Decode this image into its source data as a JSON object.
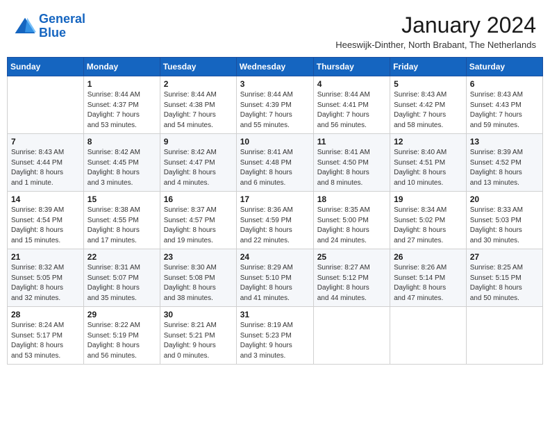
{
  "header": {
    "logo_line1": "General",
    "logo_line2": "Blue",
    "month_title": "January 2024",
    "subtitle": "Heeswijk-Dinther, North Brabant, The Netherlands"
  },
  "weekdays": [
    "Sunday",
    "Monday",
    "Tuesday",
    "Wednesday",
    "Thursday",
    "Friday",
    "Saturday"
  ],
  "weeks": [
    [
      {
        "day": "",
        "info": ""
      },
      {
        "day": "1",
        "info": "Sunrise: 8:44 AM\nSunset: 4:37 PM\nDaylight: 7 hours\nand 53 minutes."
      },
      {
        "day": "2",
        "info": "Sunrise: 8:44 AM\nSunset: 4:38 PM\nDaylight: 7 hours\nand 54 minutes."
      },
      {
        "day": "3",
        "info": "Sunrise: 8:44 AM\nSunset: 4:39 PM\nDaylight: 7 hours\nand 55 minutes."
      },
      {
        "day": "4",
        "info": "Sunrise: 8:44 AM\nSunset: 4:41 PM\nDaylight: 7 hours\nand 56 minutes."
      },
      {
        "day": "5",
        "info": "Sunrise: 8:43 AM\nSunset: 4:42 PM\nDaylight: 7 hours\nand 58 minutes."
      },
      {
        "day": "6",
        "info": "Sunrise: 8:43 AM\nSunset: 4:43 PM\nDaylight: 7 hours\nand 59 minutes."
      }
    ],
    [
      {
        "day": "7",
        "info": "Sunrise: 8:43 AM\nSunset: 4:44 PM\nDaylight: 8 hours\nand 1 minute."
      },
      {
        "day": "8",
        "info": "Sunrise: 8:42 AM\nSunset: 4:45 PM\nDaylight: 8 hours\nand 3 minutes."
      },
      {
        "day": "9",
        "info": "Sunrise: 8:42 AM\nSunset: 4:47 PM\nDaylight: 8 hours\nand 4 minutes."
      },
      {
        "day": "10",
        "info": "Sunrise: 8:41 AM\nSunset: 4:48 PM\nDaylight: 8 hours\nand 6 minutes."
      },
      {
        "day": "11",
        "info": "Sunrise: 8:41 AM\nSunset: 4:50 PM\nDaylight: 8 hours\nand 8 minutes."
      },
      {
        "day": "12",
        "info": "Sunrise: 8:40 AM\nSunset: 4:51 PM\nDaylight: 8 hours\nand 10 minutes."
      },
      {
        "day": "13",
        "info": "Sunrise: 8:39 AM\nSunset: 4:52 PM\nDaylight: 8 hours\nand 13 minutes."
      }
    ],
    [
      {
        "day": "14",
        "info": "Sunrise: 8:39 AM\nSunset: 4:54 PM\nDaylight: 8 hours\nand 15 minutes."
      },
      {
        "day": "15",
        "info": "Sunrise: 8:38 AM\nSunset: 4:55 PM\nDaylight: 8 hours\nand 17 minutes."
      },
      {
        "day": "16",
        "info": "Sunrise: 8:37 AM\nSunset: 4:57 PM\nDaylight: 8 hours\nand 19 minutes."
      },
      {
        "day": "17",
        "info": "Sunrise: 8:36 AM\nSunset: 4:59 PM\nDaylight: 8 hours\nand 22 minutes."
      },
      {
        "day": "18",
        "info": "Sunrise: 8:35 AM\nSunset: 5:00 PM\nDaylight: 8 hours\nand 24 minutes."
      },
      {
        "day": "19",
        "info": "Sunrise: 8:34 AM\nSunset: 5:02 PM\nDaylight: 8 hours\nand 27 minutes."
      },
      {
        "day": "20",
        "info": "Sunrise: 8:33 AM\nSunset: 5:03 PM\nDaylight: 8 hours\nand 30 minutes."
      }
    ],
    [
      {
        "day": "21",
        "info": "Sunrise: 8:32 AM\nSunset: 5:05 PM\nDaylight: 8 hours\nand 32 minutes."
      },
      {
        "day": "22",
        "info": "Sunrise: 8:31 AM\nSunset: 5:07 PM\nDaylight: 8 hours\nand 35 minutes."
      },
      {
        "day": "23",
        "info": "Sunrise: 8:30 AM\nSunset: 5:08 PM\nDaylight: 8 hours\nand 38 minutes."
      },
      {
        "day": "24",
        "info": "Sunrise: 8:29 AM\nSunset: 5:10 PM\nDaylight: 8 hours\nand 41 minutes."
      },
      {
        "day": "25",
        "info": "Sunrise: 8:27 AM\nSunset: 5:12 PM\nDaylight: 8 hours\nand 44 minutes."
      },
      {
        "day": "26",
        "info": "Sunrise: 8:26 AM\nSunset: 5:14 PM\nDaylight: 8 hours\nand 47 minutes."
      },
      {
        "day": "27",
        "info": "Sunrise: 8:25 AM\nSunset: 5:15 PM\nDaylight: 8 hours\nand 50 minutes."
      }
    ],
    [
      {
        "day": "28",
        "info": "Sunrise: 8:24 AM\nSunset: 5:17 PM\nDaylight: 8 hours\nand 53 minutes."
      },
      {
        "day": "29",
        "info": "Sunrise: 8:22 AM\nSunset: 5:19 PM\nDaylight: 8 hours\nand 56 minutes."
      },
      {
        "day": "30",
        "info": "Sunrise: 8:21 AM\nSunset: 5:21 PM\nDaylight: 9 hours\nand 0 minutes."
      },
      {
        "day": "31",
        "info": "Sunrise: 8:19 AM\nSunset: 5:23 PM\nDaylight: 9 hours\nand 3 minutes."
      },
      {
        "day": "",
        "info": ""
      },
      {
        "day": "",
        "info": ""
      },
      {
        "day": "",
        "info": ""
      }
    ]
  ]
}
